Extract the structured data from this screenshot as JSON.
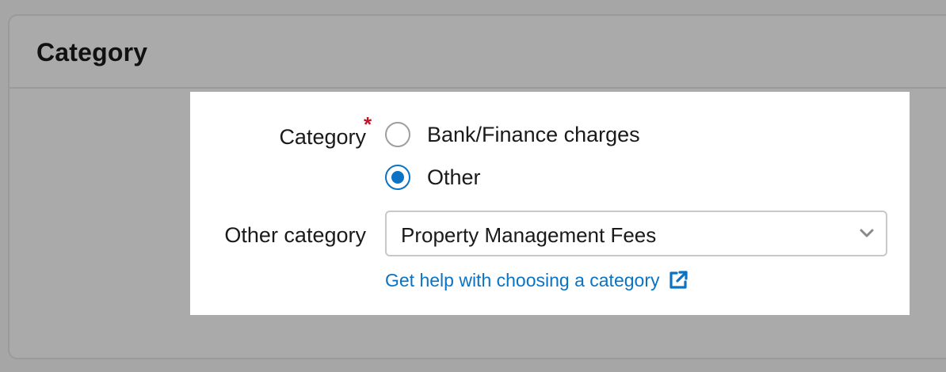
{
  "panel": {
    "title": "Category"
  },
  "form": {
    "category_label": "Category",
    "required_marker": "*",
    "options": [
      {
        "label": "Bank/Finance charges",
        "selected": false
      },
      {
        "label": "Other",
        "selected": true
      }
    ],
    "other_category_label": "Other category",
    "other_category_value": "Property Management Fees",
    "help_link": "Get help with choosing a category"
  },
  "colors": {
    "accent": "#0a73c4",
    "required": "#c0152a"
  },
  "icons": {
    "select_chevron": "chevron-down-icon",
    "help_link": "external-link-icon"
  }
}
